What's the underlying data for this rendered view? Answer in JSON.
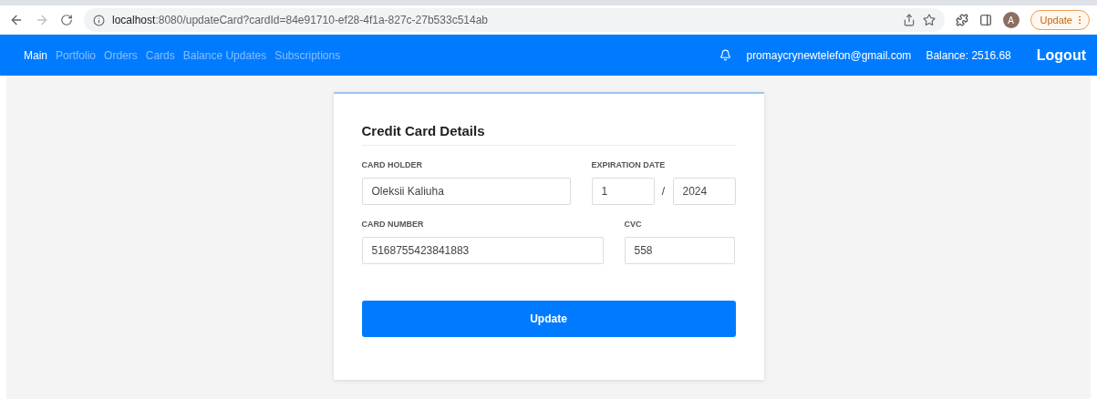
{
  "browser": {
    "url_host": "localhost",
    "url_rest": ":8080/updateCard?cardId=84e91710-ef28-4f1a-827c-27b533c514ab",
    "profile_initial": "A",
    "update_label": "Update"
  },
  "navbar": {
    "links": [
      {
        "label": "Main",
        "selected": true
      },
      {
        "label": "Portfolio",
        "selected": false
      },
      {
        "label": "Orders",
        "selected": false
      },
      {
        "label": "Cards",
        "selected": false
      },
      {
        "label": "Balance Updates",
        "selected": false
      },
      {
        "label": "Subscriptions",
        "selected": false
      }
    ],
    "email": "promaycrynewtelefon@gmail.com",
    "balance": "Balance: 2516.68",
    "logout": "Logout"
  },
  "form": {
    "title": "Credit Card Details",
    "card_holder": {
      "label": "CARD HOLDER",
      "value": "Oleksii Kaliuha"
    },
    "expiration": {
      "label": "EXPIRATION DATE",
      "month": "1",
      "separator": "/",
      "year": "2024"
    },
    "card_number": {
      "label": "CARD NUMBER",
      "value": "5168755423841883"
    },
    "cvc": {
      "label": "CVC",
      "value": "558"
    },
    "submit": "Update"
  }
}
